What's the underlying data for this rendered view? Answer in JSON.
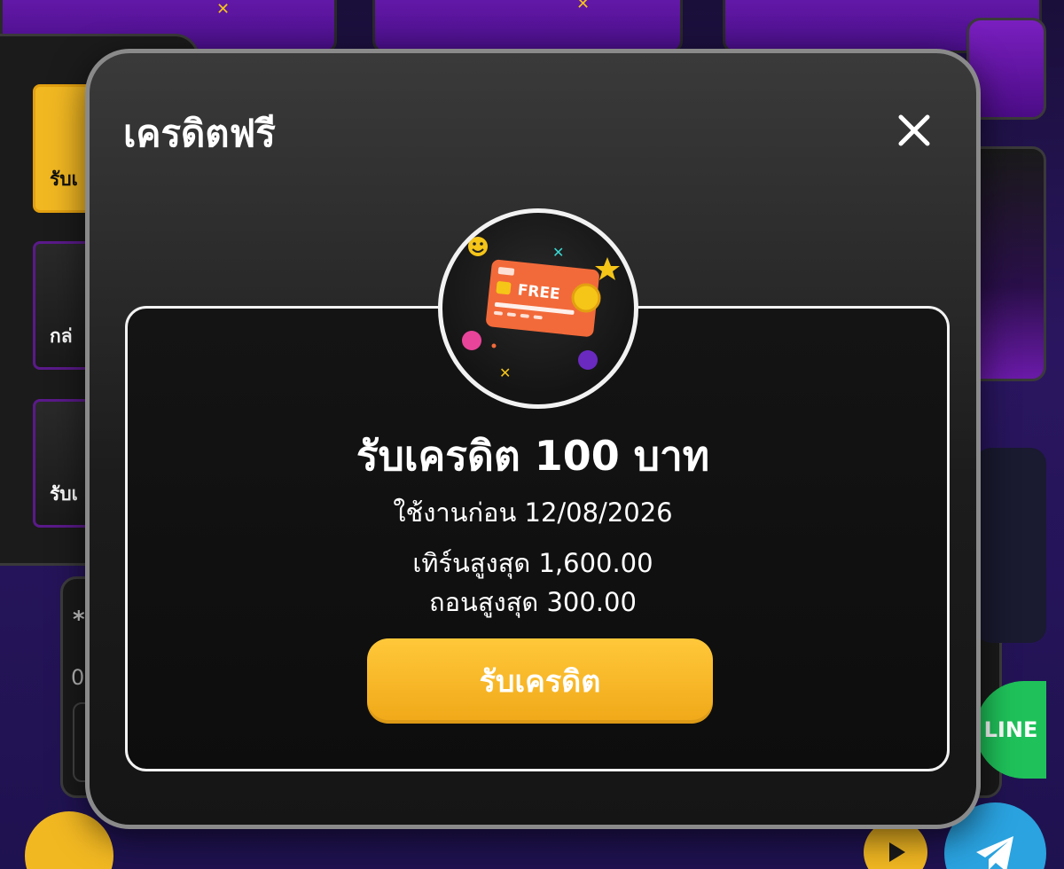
{
  "modal": {
    "title": "เครดิตฟรี",
    "close_icon": "close-icon",
    "badge_icon": "free-credit-card-icon",
    "badge_card_text": "FREE",
    "offer_title": "รับเครดิต 100 บาท",
    "expiry_text": "ใช้งานก่อน 12/08/2026",
    "max_turnover_text": "เทิร์นสูงสุด 1,600.00",
    "max_withdraw_text": "ถอนสูงสุด 300.00",
    "claim_button_label": "รับเครดิต"
  },
  "background": {
    "side_cards": [
      {
        "label": "รับเ"
      },
      {
        "label": "กล่"
      },
      {
        "label": "รับเ"
      }
    ],
    "lower_panel_line_1": "*",
    "lower_panel_line_2": "0",
    "line_button_label": "LINE",
    "play_icon": "play-icon",
    "telegram_icon": "telegram-icon"
  },
  "colors": {
    "accent_gold": "#f2b822",
    "modal_bg": "#1c1c1c",
    "card_orange": "#f26a3a",
    "line_green": "#1fc25a",
    "telegram_blue": "#2aa3e0"
  }
}
